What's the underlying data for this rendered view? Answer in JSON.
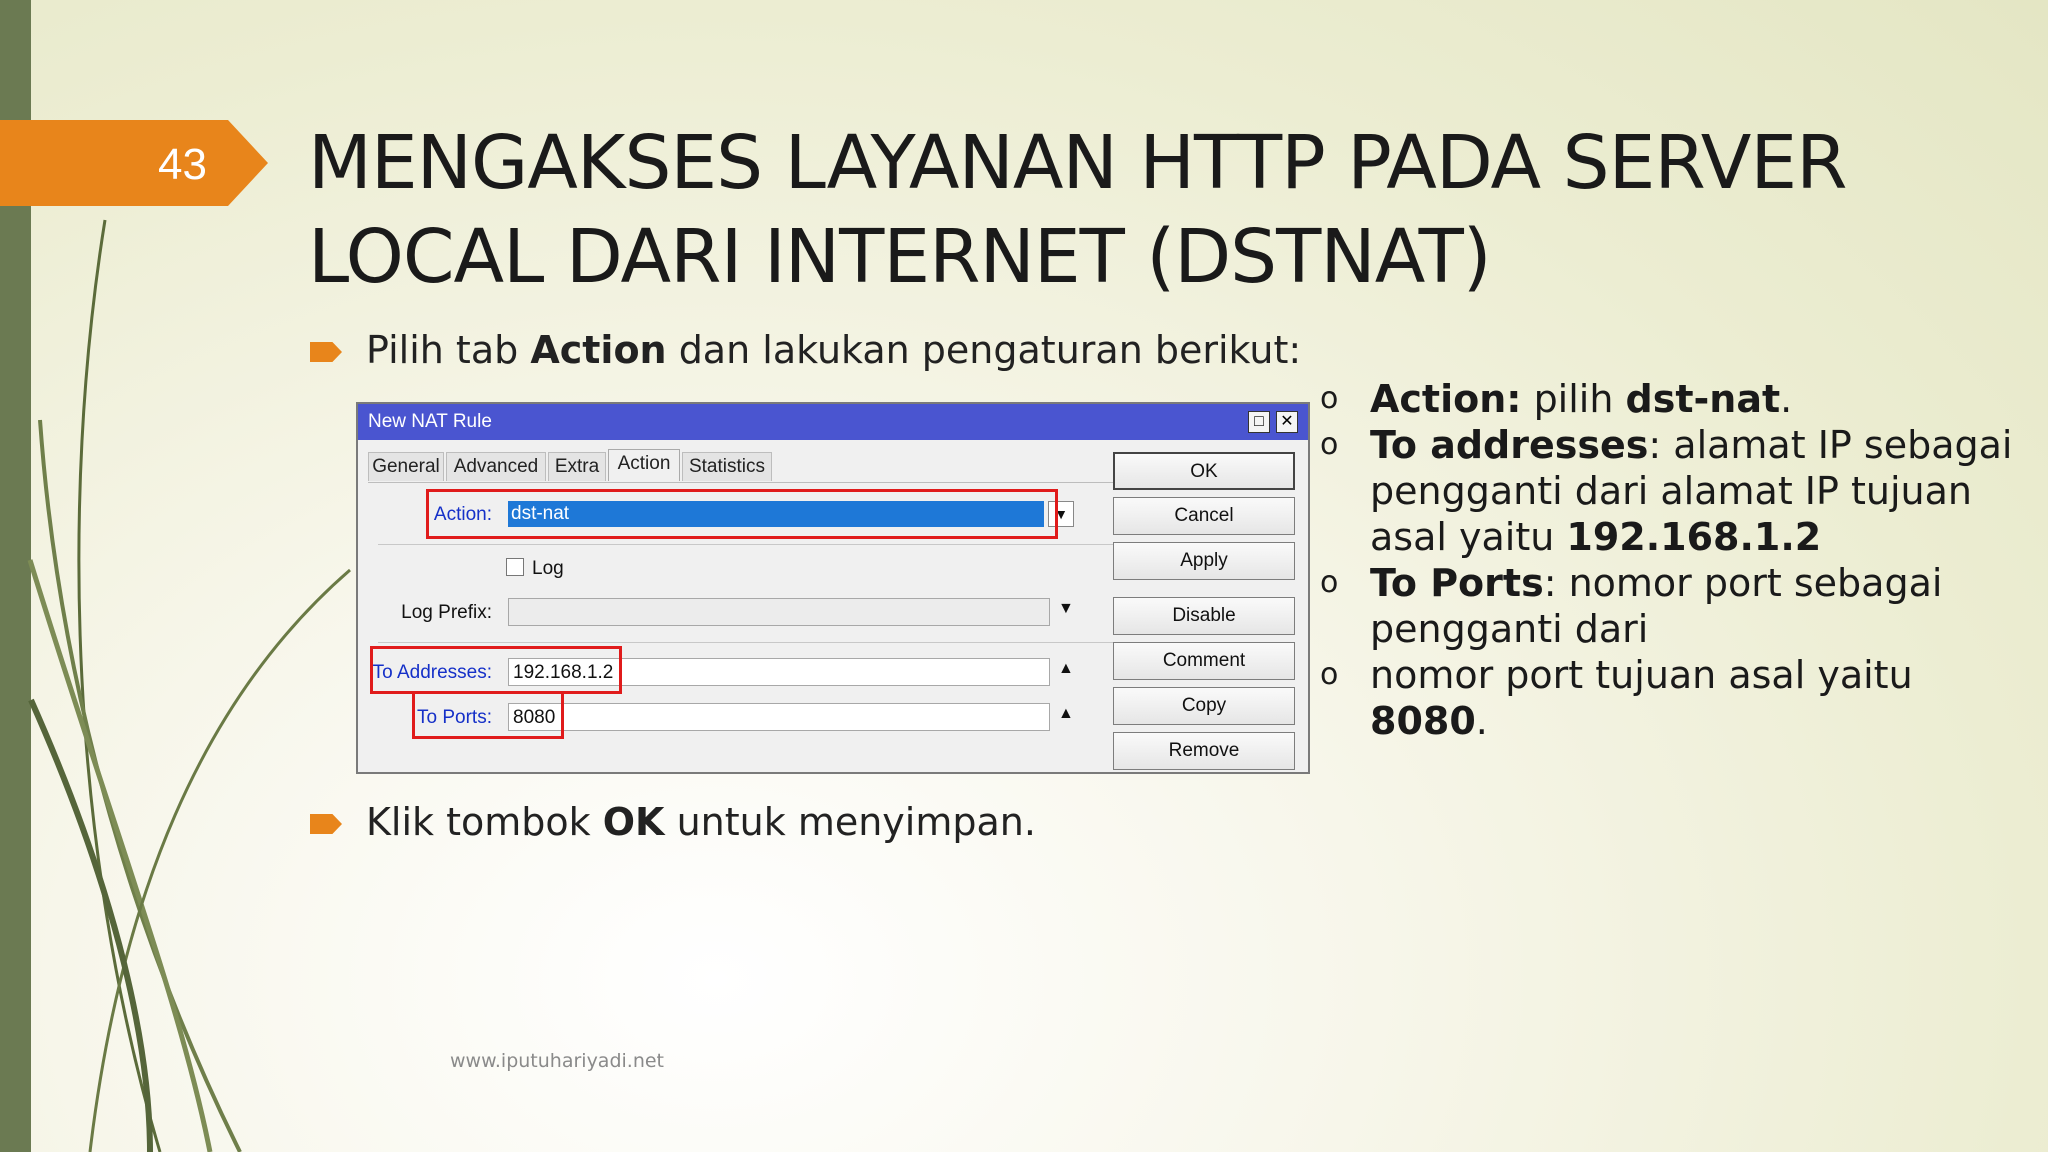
{
  "slide_number": "43",
  "title": {
    "line1": "MENGAKSES LAYANAN HTTP PADA SERVER",
    "line2": "LOCAL DARI INTERNET (DSTNAT)"
  },
  "bullet1": {
    "pre": "Pilih tab ",
    "bold": "Action",
    "post": " dan lakukan pengaturan berikut:"
  },
  "bullet2": {
    "pre": "Klik tombok ",
    "bold": "OK",
    "post": " untuk menyimpan."
  },
  "dialog": {
    "title": "New NAT Rule",
    "tabs": [
      "General",
      "Advanced",
      "Extra",
      "Action",
      "Statistics"
    ],
    "active_tab": "Action",
    "action_label": "Action:",
    "action_value": "dst-nat",
    "log_label": "Log",
    "log_prefix_label": "Log Prefix:",
    "log_prefix_value": "",
    "to_addresses_label": "To Addresses:",
    "to_addresses_value": "192.168.1.2",
    "to_ports_label": "To Ports:",
    "to_ports_value": "8080",
    "buttons": [
      "OK",
      "Cancel",
      "Apply",
      "Disable",
      "Comment",
      "Copy",
      "Remove"
    ]
  },
  "right_list": {
    "item1": {
      "bold": "Action:",
      "mid": " pilih ",
      "bold2": "dst-nat",
      "end": "."
    },
    "item2": {
      "bold": "To addresses",
      "rest": ": alamat IP sebagai pengganti dari alamat IP tujuan asal yaitu ",
      "bold2": "192.168.1.2"
    },
    "item3": {
      "bold": "To Ports",
      "rest": ": nomor port sebagai pengganti dari"
    },
    "item4": {
      "rest": "nomor port tujuan asal yaitu ",
      "bold2": "8080",
      "end": "."
    }
  },
  "footer": "www.iputuhariyadi.net",
  "colors": {
    "accent": "#e8851b",
    "left_bar": "#6b7a52",
    "dialog_title": "#4a55d0",
    "highlight": "#e01b1b"
  }
}
